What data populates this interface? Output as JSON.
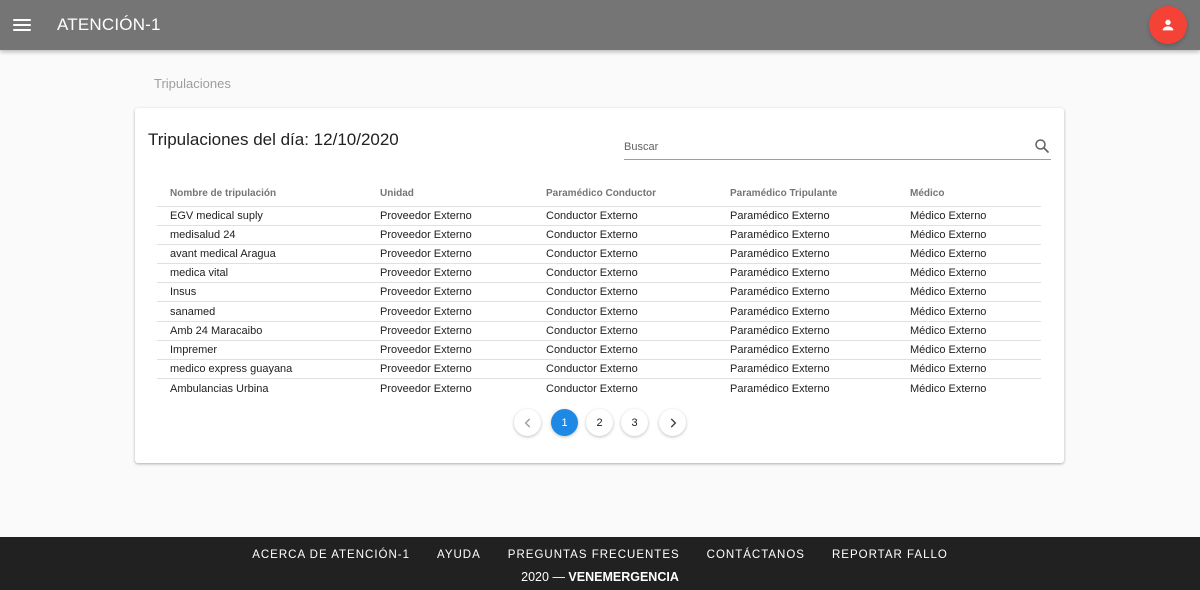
{
  "header": {
    "title": "ATENCIÓN-1",
    "menu_icon": "menu-icon",
    "avatar_icon": "person-icon",
    "avatar_color": "#f44336"
  },
  "breadcrumb": "Tripulaciones",
  "card": {
    "title": "Tripulaciones del día: 12/10/2020",
    "search": {
      "placeholder": "Buscar",
      "value": "",
      "icon": "search-icon"
    }
  },
  "table": {
    "headers": [
      "Nombre de tripulación",
      "Unidad",
      "Paramédico Conductor",
      "Paramédico Tripulante",
      "Médico"
    ],
    "rows": [
      [
        "EGV medical suply",
        "Proveedor Externo",
        "Conductor Externo",
        "Paramédico Externo",
        "Médico Externo"
      ],
      [
        "medisalud 24",
        "Proveedor Externo",
        "Conductor Externo",
        "Paramédico Externo",
        "Médico Externo"
      ],
      [
        "avant medical Aragua",
        "Proveedor Externo",
        "Conductor Externo",
        "Paramédico Externo",
        "Médico Externo"
      ],
      [
        "medica vital",
        "Proveedor Externo",
        "Conductor Externo",
        "Paramédico Externo",
        "Médico Externo"
      ],
      [
        "Insus",
        "Proveedor Externo",
        "Conductor Externo",
        "Paramédico Externo",
        "Médico Externo"
      ],
      [
        "sanamed",
        "Proveedor Externo",
        "Conductor Externo",
        "Paramédico Externo",
        "Médico Externo"
      ],
      [
        "Amb 24 Maracaibo",
        "Proveedor Externo",
        "Conductor Externo",
        "Paramédico Externo",
        "Médico Externo"
      ],
      [
        "Impremer",
        "Proveedor Externo",
        "Conductor Externo",
        "Paramédico Externo",
        "Médico Externo"
      ],
      [
        "medico express guayana",
        "Proveedor Externo",
        "Conductor Externo",
        "Paramédico Externo",
        "Médico Externo"
      ],
      [
        "Ambulancias Urbina",
        "Proveedor Externo",
        "Conductor Externo",
        "Paramédico Externo",
        "Médico Externo"
      ]
    ]
  },
  "pagination": {
    "pages": [
      "1",
      "2",
      "3"
    ],
    "current": "1",
    "prev_icon": "chevron-left-icon",
    "next_icon": "chevron-right-icon",
    "accent": "#1e88e5"
  },
  "footer": {
    "links": [
      "Acerca de Atención-1",
      "Ayuda",
      "Preguntas frecuentes",
      "Contáctanos",
      "Reportar fallo"
    ],
    "year": "2020",
    "separator": "—",
    "org": "VENEMERGENCIA"
  }
}
